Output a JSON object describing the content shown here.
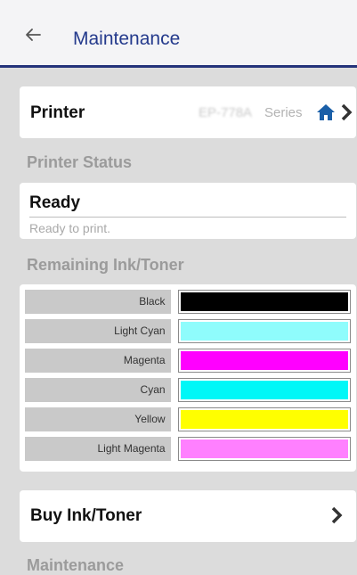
{
  "header": {
    "title": "Maintenance"
  },
  "printer": {
    "label": "Printer",
    "model": "EP-778A",
    "series": "Series"
  },
  "status": {
    "heading": "Printer Status",
    "title": "Ready",
    "description": "Ready to print."
  },
  "ink": {
    "heading": "Remaining Ink/Toner",
    "items": [
      {
        "name": "Black",
        "color": "#000000",
        "level": 1.0
      },
      {
        "name": "Light Cyan",
        "color": "#8ffcfc",
        "level": 1.0
      },
      {
        "name": "Magenta",
        "color": "#ff00ff",
        "level": 1.0
      },
      {
        "name": "Cyan",
        "color": "#00f7f7",
        "level": 1.0
      },
      {
        "name": "Yellow",
        "color": "#ffff00",
        "level": 1.0
      },
      {
        "name": "Light Magenta",
        "color": "#ff80ff",
        "level": 1.0
      }
    ]
  },
  "buy": {
    "label": "Buy Ink/Toner"
  },
  "next_section": {
    "heading": "Maintenance"
  },
  "colors": {
    "accent": "#243a8c",
    "background": "#dcdcdc"
  }
}
